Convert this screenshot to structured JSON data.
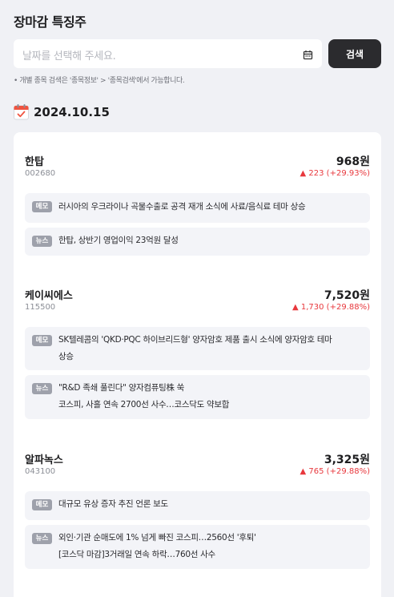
{
  "page": {
    "title": "장마감 특징주"
  },
  "search": {
    "placeholder": "날짜를 선택해 주세요.",
    "calendar_icon": "calendar-icon",
    "button_label": "검색"
  },
  "hint": "• 개별 종목 검색은 '종목정보' > '종목검색'에서 가능합니다.",
  "date_section": {
    "icon": "calendar-emoji-icon",
    "date": "2024.10.15"
  },
  "colors": {
    "up": "#e8383d",
    "button": "#2b2b2e",
    "background": "#f0f1f5"
  },
  "stocks": [
    {
      "name": "한탑",
      "code": "002680",
      "price": "968원",
      "change": "▲ 223 (+29.93%)",
      "memo": {
        "tag": "메모",
        "lines": [
          "러시아의 우크라이나 곡물수출로 공격 재개 소식에 사료/음식료 테마 상승"
        ]
      },
      "news": {
        "tag": "뉴스",
        "lines": [
          "한탑, 상반기 영업이익 23억원 달성"
        ]
      }
    },
    {
      "name": "케이씨에스",
      "code": "115500",
      "price": "7,520원",
      "change": "▲ 1,730 (+29.88%)",
      "memo": {
        "tag": "메모",
        "lines": [
          "SK텔레콤의 'QKD·PQC 하이브리드형' 양자암호 제품 출시 소식에 양자암호 테마",
          "상승"
        ]
      },
      "news": {
        "tag": "뉴스",
        "lines": [
          "\"R&D 족쇄 풀린다\" 양자컴퓨팅株 쑥",
          "코스피, 사흘 연속 2700선 사수…코스닥도 약보합"
        ]
      }
    },
    {
      "name": "알파녹스",
      "code": "043100",
      "price": "3,325원",
      "change": "▲ 765 (+29.88%)",
      "memo": {
        "tag": "메모",
        "lines": [
          "대규모 유상 증자 추진 언론 보도"
        ]
      },
      "news": {
        "tag": "뉴스",
        "lines": [
          "외인·기관 순매도에 1% 넘게 빠진 코스피…2560선 '후퇴'",
          "[코스닥 마감]3거래일 연속 하락…760선 사수"
        ]
      }
    }
  ]
}
